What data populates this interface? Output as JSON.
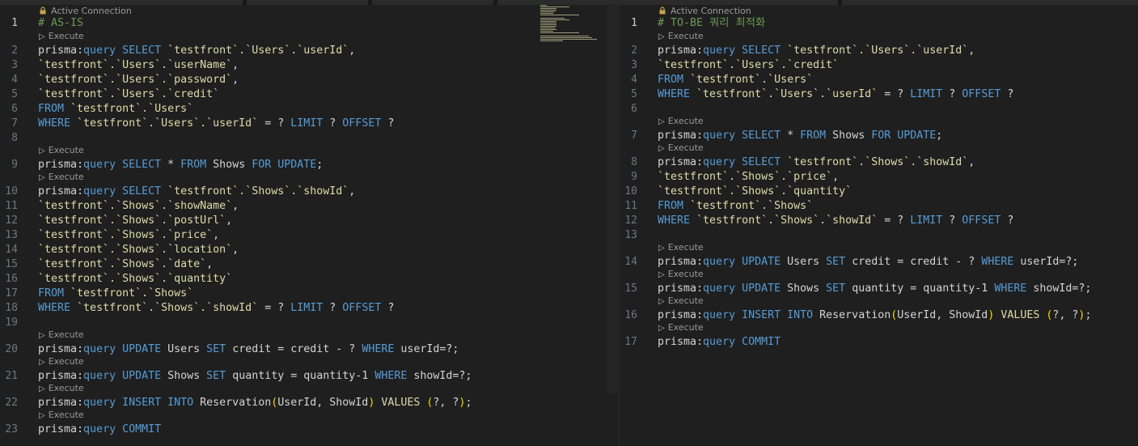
{
  "left_editor": {
    "connection_label": "Active Connection",
    "execute_label": "Execute",
    "lines": [
      {
        "n": "1",
        "tokens": [
          {
            "t": "# AS-IS",
            "c": "cmt"
          }
        ]
      },
      {
        "n": "2",
        "tokens": [
          {
            "t": "prisma:",
            "c": "txt"
          },
          {
            "t": "query",
            "c": "kw"
          },
          {
            "t": " SELECT ",
            "c": "kw"
          },
          {
            "t": "`testfront`.`Users`.`userId`",
            "c": "tbl"
          },
          {
            "t": ",",
            "c": "txt"
          }
        ]
      },
      {
        "n": "3",
        "tokens": [
          {
            "t": "`testfront`.`Users`.`userName`",
            "c": "tbl"
          },
          {
            "t": ",",
            "c": "txt"
          }
        ]
      },
      {
        "n": "4",
        "tokens": [
          {
            "t": "`testfront`.`Users`.`password`",
            "c": "tbl"
          },
          {
            "t": ",",
            "c": "txt"
          }
        ]
      },
      {
        "n": "5",
        "tokens": [
          {
            "t": "`testfront`.`Users`.`credit`",
            "c": "tbl"
          }
        ]
      },
      {
        "n": "6",
        "tokens": [
          {
            "t": "FROM ",
            "c": "kw"
          },
          {
            "t": "`testfront`.`Users`",
            "c": "tbl"
          }
        ]
      },
      {
        "n": "7",
        "tokens": [
          {
            "t": "WHERE ",
            "c": "kw"
          },
          {
            "t": "`testfront`.`Users`.`userId`",
            "c": "tbl"
          },
          {
            "t": " = ? ",
            "c": "op"
          },
          {
            "t": "LIMIT",
            "c": "kw"
          },
          {
            "t": " ? ",
            "c": "op"
          },
          {
            "t": "OFFSET",
            "c": "kw"
          },
          {
            "t": " ?",
            "c": "op"
          }
        ]
      },
      {
        "n": "8",
        "tokens": []
      },
      {
        "n": "9",
        "tokens": [
          {
            "t": "prisma:",
            "c": "txt"
          },
          {
            "t": "query",
            "c": "kw"
          },
          {
            "t": " SELECT ",
            "c": "kw"
          },
          {
            "t": "* ",
            "c": "op"
          },
          {
            "t": "FROM ",
            "c": "kw"
          },
          {
            "t": "Shows ",
            "c": "txt"
          },
          {
            "t": "FOR UPDATE",
            "c": "kw"
          },
          {
            "t": ";",
            "c": "txt"
          }
        ]
      },
      {
        "n": "10",
        "tokens": [
          {
            "t": "prisma:",
            "c": "txt"
          },
          {
            "t": "query",
            "c": "kw"
          },
          {
            "t": " SELECT ",
            "c": "kw"
          },
          {
            "t": "`testfront`.`Shows`.`showId`",
            "c": "tbl"
          },
          {
            "t": ",",
            "c": "txt"
          }
        ]
      },
      {
        "n": "11",
        "tokens": [
          {
            "t": "`testfront`.`Shows`.`showName`",
            "c": "tbl"
          },
          {
            "t": ",",
            "c": "txt"
          }
        ]
      },
      {
        "n": "12",
        "tokens": [
          {
            "t": "`testfront`.`Shows`.`postUrl`",
            "c": "tbl"
          },
          {
            "t": ",",
            "c": "txt"
          }
        ]
      },
      {
        "n": "13",
        "tokens": [
          {
            "t": "`testfront`.`Shows`.`price`",
            "c": "tbl"
          },
          {
            "t": ",",
            "c": "txt"
          }
        ]
      },
      {
        "n": "14",
        "tokens": [
          {
            "t": "`testfront`.`Shows`.`location`",
            "c": "tbl"
          },
          {
            "t": ",",
            "c": "txt"
          }
        ]
      },
      {
        "n": "15",
        "tokens": [
          {
            "t": "`testfront`.`Shows`.`date`",
            "c": "tbl"
          },
          {
            "t": ",",
            "c": "txt"
          }
        ]
      },
      {
        "n": "16",
        "tokens": [
          {
            "t": "`testfront`.`Shows`.`quantity`",
            "c": "tbl"
          }
        ]
      },
      {
        "n": "17",
        "tokens": [
          {
            "t": "FROM ",
            "c": "kw"
          },
          {
            "t": "`testfront`.`Shows`",
            "c": "tbl"
          }
        ]
      },
      {
        "n": "18",
        "tokens": [
          {
            "t": "WHERE ",
            "c": "kw"
          },
          {
            "t": "`testfront`.`Shows`.`showId`",
            "c": "tbl"
          },
          {
            "t": " = ? ",
            "c": "op"
          },
          {
            "t": "LIMIT",
            "c": "kw"
          },
          {
            "t": " ? ",
            "c": "op"
          },
          {
            "t": "OFFSET",
            "c": "kw"
          },
          {
            "t": " ?",
            "c": "op"
          }
        ]
      },
      {
        "n": "19",
        "tokens": []
      },
      {
        "n": "20",
        "tokens": [
          {
            "t": "prisma:",
            "c": "txt"
          },
          {
            "t": "query",
            "c": "kw"
          },
          {
            "t": " UPDATE ",
            "c": "kw"
          },
          {
            "t": "Users ",
            "c": "txt"
          },
          {
            "t": "SET ",
            "c": "kw"
          },
          {
            "t": "credit = credit - ? ",
            "c": "txt"
          },
          {
            "t": "WHERE ",
            "c": "kw"
          },
          {
            "t": "userId=?;",
            "c": "txt"
          }
        ]
      },
      {
        "n": "21",
        "tokens": [
          {
            "t": "prisma:",
            "c": "txt"
          },
          {
            "t": "query",
            "c": "kw"
          },
          {
            "t": " UPDATE ",
            "c": "kw"
          },
          {
            "t": "Shows ",
            "c": "txt"
          },
          {
            "t": "SET ",
            "c": "kw"
          },
          {
            "t": "quantity = quantity-1 ",
            "c": "txt"
          },
          {
            "t": "WHERE ",
            "c": "kw"
          },
          {
            "t": "showId=?;",
            "c": "txt"
          }
        ]
      },
      {
        "n": "22",
        "tokens": [
          {
            "t": "prisma:",
            "c": "txt"
          },
          {
            "t": "query",
            "c": "kw"
          },
          {
            "t": " INSERT INTO ",
            "c": "kw"
          },
          {
            "t": "Reservation",
            "c": "txt"
          },
          {
            "t": "(",
            "c": "br"
          },
          {
            "t": "UserId, ShowId",
            "c": "txt"
          },
          {
            "t": ")",
            "c": "br"
          },
          {
            "t": " VALUES ",
            "c": "tbl"
          },
          {
            "t": "(",
            "c": "br"
          },
          {
            "t": "?, ?",
            "c": "txt"
          },
          {
            "t": ")",
            "c": "br"
          },
          {
            "t": ";",
            "c": "txt"
          }
        ]
      },
      {
        "n": "23",
        "tokens": [
          {
            "t": "prisma:",
            "c": "txt"
          },
          {
            "t": "query",
            "c": "kw"
          },
          {
            "t": " COMMIT",
            "c": "kw"
          }
        ]
      }
    ]
  },
  "right_editor": {
    "connection_label": "Active Connection",
    "execute_label": "Execute",
    "lines": [
      {
        "n": "1",
        "tokens": [
          {
            "t": "# TO-BE 쿼리 최적화",
            "c": "cmt"
          }
        ]
      },
      {
        "n": "2",
        "tokens": [
          {
            "t": "prisma:",
            "c": "txt"
          },
          {
            "t": "query",
            "c": "kw"
          },
          {
            "t": " SELECT ",
            "c": "kw"
          },
          {
            "t": "`testfront`.`Users`.`userId`",
            "c": "tbl"
          },
          {
            "t": ",",
            "c": "txt"
          }
        ]
      },
      {
        "n": "3",
        "tokens": [
          {
            "t": "`testfront`.`Users`.`credit`",
            "c": "tbl"
          }
        ]
      },
      {
        "n": "4",
        "tokens": [
          {
            "t": "FROM ",
            "c": "kw"
          },
          {
            "t": "`testfront`.`Users`",
            "c": "tbl"
          }
        ]
      },
      {
        "n": "5",
        "tokens": [
          {
            "t": "WHERE ",
            "c": "kw"
          },
          {
            "t": "`testfront`.`Users`.`userId`",
            "c": "tbl"
          },
          {
            "t": " = ? ",
            "c": "op"
          },
          {
            "t": "LIMIT",
            "c": "kw"
          },
          {
            "t": " ? ",
            "c": "op"
          },
          {
            "t": "OFFSET",
            "c": "kw"
          },
          {
            "t": " ?",
            "c": "op"
          }
        ]
      },
      {
        "n": "6",
        "tokens": []
      },
      {
        "n": "7",
        "tokens": [
          {
            "t": "prisma:",
            "c": "txt"
          },
          {
            "t": "query",
            "c": "kw"
          },
          {
            "t": " SELECT ",
            "c": "kw"
          },
          {
            "t": "* ",
            "c": "op"
          },
          {
            "t": "FROM ",
            "c": "kw"
          },
          {
            "t": "Shows ",
            "c": "txt"
          },
          {
            "t": "FOR UPDATE",
            "c": "kw"
          },
          {
            "t": ";",
            "c": "txt"
          }
        ]
      },
      {
        "n": "8",
        "tokens": [
          {
            "t": "prisma:",
            "c": "txt"
          },
          {
            "t": "query",
            "c": "kw"
          },
          {
            "t": " SELECT ",
            "c": "kw"
          },
          {
            "t": "`testfront`.`Shows`.`showId`",
            "c": "tbl"
          },
          {
            "t": ",",
            "c": "txt"
          }
        ]
      },
      {
        "n": "9",
        "tokens": [
          {
            "t": "`testfront`.`Shows`.`price`",
            "c": "tbl"
          },
          {
            "t": ",",
            "c": "txt"
          }
        ]
      },
      {
        "n": "10",
        "tokens": [
          {
            "t": "`testfront`.`Shows`.`quantity`",
            "c": "tbl"
          }
        ]
      },
      {
        "n": "11",
        "tokens": [
          {
            "t": "FROM ",
            "c": "kw"
          },
          {
            "t": "`testfront`.`Shows`",
            "c": "tbl"
          }
        ]
      },
      {
        "n": "12",
        "tokens": [
          {
            "t": "WHERE ",
            "c": "kw"
          },
          {
            "t": "`testfront`.`Shows`.`showId`",
            "c": "tbl"
          },
          {
            "t": " = ? ",
            "c": "op"
          },
          {
            "t": "LIMIT",
            "c": "kw"
          },
          {
            "t": " ? ",
            "c": "op"
          },
          {
            "t": "OFFSET",
            "c": "kw"
          },
          {
            "t": " ?",
            "c": "op"
          }
        ]
      },
      {
        "n": "13",
        "tokens": []
      },
      {
        "n": "14",
        "tokens": [
          {
            "t": "prisma:",
            "c": "txt"
          },
          {
            "t": "query",
            "c": "kw"
          },
          {
            "t": " UPDATE ",
            "c": "kw"
          },
          {
            "t": "Users ",
            "c": "txt"
          },
          {
            "t": "SET ",
            "c": "kw"
          },
          {
            "t": "credit = credit - ? ",
            "c": "txt"
          },
          {
            "t": "WHERE ",
            "c": "kw"
          },
          {
            "t": "userId=?;",
            "c": "txt"
          }
        ]
      },
      {
        "n": "15",
        "tokens": [
          {
            "t": "prisma:",
            "c": "txt"
          },
          {
            "t": "query",
            "c": "kw"
          },
          {
            "t": " UPDATE ",
            "c": "kw"
          },
          {
            "t": "Shows ",
            "c": "txt"
          },
          {
            "t": "SET ",
            "c": "kw"
          },
          {
            "t": "quantity = quantity-1 ",
            "c": "txt"
          },
          {
            "t": "WHERE ",
            "c": "kw"
          },
          {
            "t": "showId=?;",
            "c": "txt"
          }
        ]
      },
      {
        "n": "16",
        "tokens": [
          {
            "t": "prisma:",
            "c": "txt"
          },
          {
            "t": "query",
            "c": "kw"
          },
          {
            "t": " INSERT INTO ",
            "c": "kw"
          },
          {
            "t": "Reservation",
            "c": "txt"
          },
          {
            "t": "(",
            "c": "br"
          },
          {
            "t": "UserId, ShowId",
            "c": "txt"
          },
          {
            "t": ")",
            "c": "br"
          },
          {
            "t": " VALUES ",
            "c": "tbl"
          },
          {
            "t": "(",
            "c": "br"
          },
          {
            "t": "?, ?",
            "c": "txt"
          },
          {
            "t": ")",
            "c": "br"
          },
          {
            "t": ";",
            "c": "txt"
          }
        ]
      },
      {
        "n": "17",
        "tokens": [
          {
            "t": "prisma:",
            "c": "txt"
          },
          {
            "t": "query",
            "c": "kw"
          },
          {
            "t": " COMMIT",
            "c": "kw"
          }
        ]
      }
    ]
  },
  "colors": {
    "comment": "#6a9955",
    "keyword": "#569cd6",
    "identifier": "#dcdcaa",
    "bracket": "#ffd700",
    "text": "#d4d4d4",
    "background": "#1f1f1f"
  }
}
